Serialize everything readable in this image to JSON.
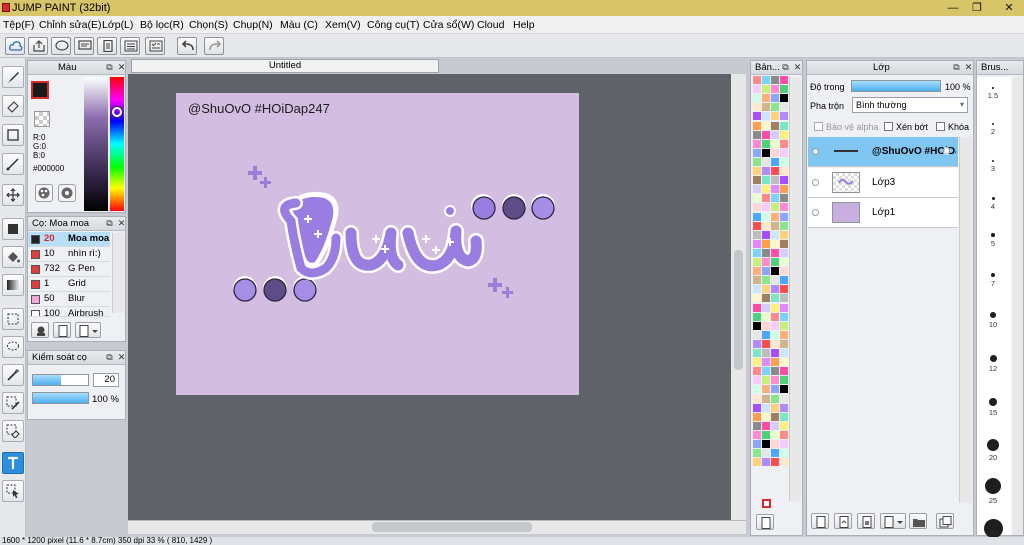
{
  "window": {
    "title": "JUMP PAINT (32bit)",
    "minimize": "—",
    "maximize": "❐",
    "close": "✕"
  },
  "menu": [
    "Tệp(F)",
    "Chỉnh sửa(E)",
    "Lớp(L)",
    "Bộ lọc(R)",
    "Chọn(S)",
    "Chụp(N)",
    "Màu (C)",
    "Xem(V)",
    "Công cụ(T)",
    "Cửa sổ(W)",
    "Cloud",
    "Help"
  ],
  "color_panel": {
    "title": "Màu",
    "r": "R:0",
    "g": "G:0",
    "b": "B:0",
    "hex": "#000000",
    "fg": "#1a1a1a",
    "fg_border": "#d62b2b"
  },
  "brush_panel": {
    "title": "Cọ: Moa moa",
    "items": [
      {
        "size": "20",
        "name": "Moa moa",
        "color": "#222222"
      },
      {
        "size": "10",
        "name": "nhìn rì:)",
        "color": "#e23c3c"
      },
      {
        "size": "732",
        "name": "G Pen",
        "color": "#e23c3c"
      },
      {
        "size": "1",
        "name": "Grid",
        "color": "#e23c3c"
      },
      {
        "size": "50",
        "name": "Blur",
        "color": "#f4a6d8"
      },
      {
        "size": "100",
        "name": "Airbrush",
        "color": "#ffffff"
      }
    ]
  },
  "brush_control": {
    "title": "Kiểm soát cọ",
    "size_value": "20",
    "size_fraction": 0.5,
    "opacity_value": "100 %",
    "opacity_fraction": 1.0
  },
  "document": {
    "tab": "Untitled",
    "watermark": "@ShuOvO #HOiDap247",
    "artboard_color": "#d3bde0"
  },
  "palette_panel": {
    "title": "Bản..."
  },
  "layer_panel": {
    "title": "Lớp",
    "opacity_label": "Độ trong",
    "opacity_value": "100 %",
    "blend_label": "Pha trộn",
    "blend_value": "Bình thường",
    "alpha_protect": "Bảo vệ alpha",
    "clip": "Xén bớt",
    "lock": "Khóa",
    "layers": [
      {
        "name": "@ShuOvO #HOiDap",
        "selected": true
      },
      {
        "name": "Lớp3",
        "selected": false
      },
      {
        "name": "Lớp1",
        "selected": false
      }
    ]
  },
  "brush_size_panel": {
    "title": "Brus...",
    "sizes": [
      "1.5",
      "2",
      "3",
      "4",
      "5",
      "7",
      "10",
      "12",
      "15",
      "20",
      "25",
      "30"
    ]
  },
  "status": {
    "text": "1600 * 1200 pixel   (11.6 * 8.7cm)   350 dpi   33 %   ( 810, 1429 )"
  }
}
